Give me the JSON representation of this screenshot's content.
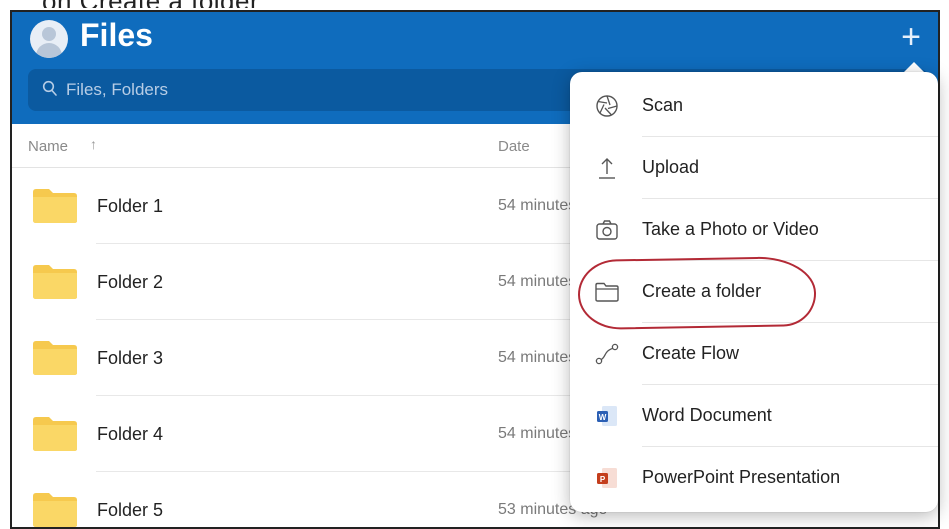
{
  "caption": "on Create a folder",
  "header": {
    "title": "Files",
    "plus_icon": "plus-icon",
    "avatar_icon": "user-avatar-icon",
    "color": "#0f6cbd"
  },
  "search": {
    "placeholder": "Files, Folders",
    "icon": "search-icon"
  },
  "columns": {
    "name": "Name",
    "sort_icon": "sort-ascending-icon",
    "date": "Date"
  },
  "rows": [
    {
      "name": "Folder 1",
      "date": "54 minutes ago"
    },
    {
      "name": "Folder 2",
      "date": "54 minutes ago"
    },
    {
      "name": "Folder 3",
      "date": "54 minutes ago"
    },
    {
      "name": "Folder 4",
      "date": "54 minutes ago"
    },
    {
      "name": "Folder 5",
      "date": "53 minutes ago"
    }
  ],
  "folder_color": "#f6c94e",
  "menu": {
    "items": [
      {
        "label": "Scan",
        "icon": "camera-aperture-icon"
      },
      {
        "label": "Upload",
        "icon": "upload-arrow-icon"
      },
      {
        "label": "Take a Photo or Video",
        "icon": "camera-icon"
      },
      {
        "label": "Create a folder",
        "icon": "folder-outline-icon"
      },
      {
        "label": "Create Flow",
        "icon": "flow-icon"
      },
      {
        "label": "Word Document",
        "icon": "word-icon"
      },
      {
        "label": "PowerPoint Presentation",
        "icon": "powerpoint-icon"
      }
    ]
  },
  "annotation_color": "#b32a36"
}
